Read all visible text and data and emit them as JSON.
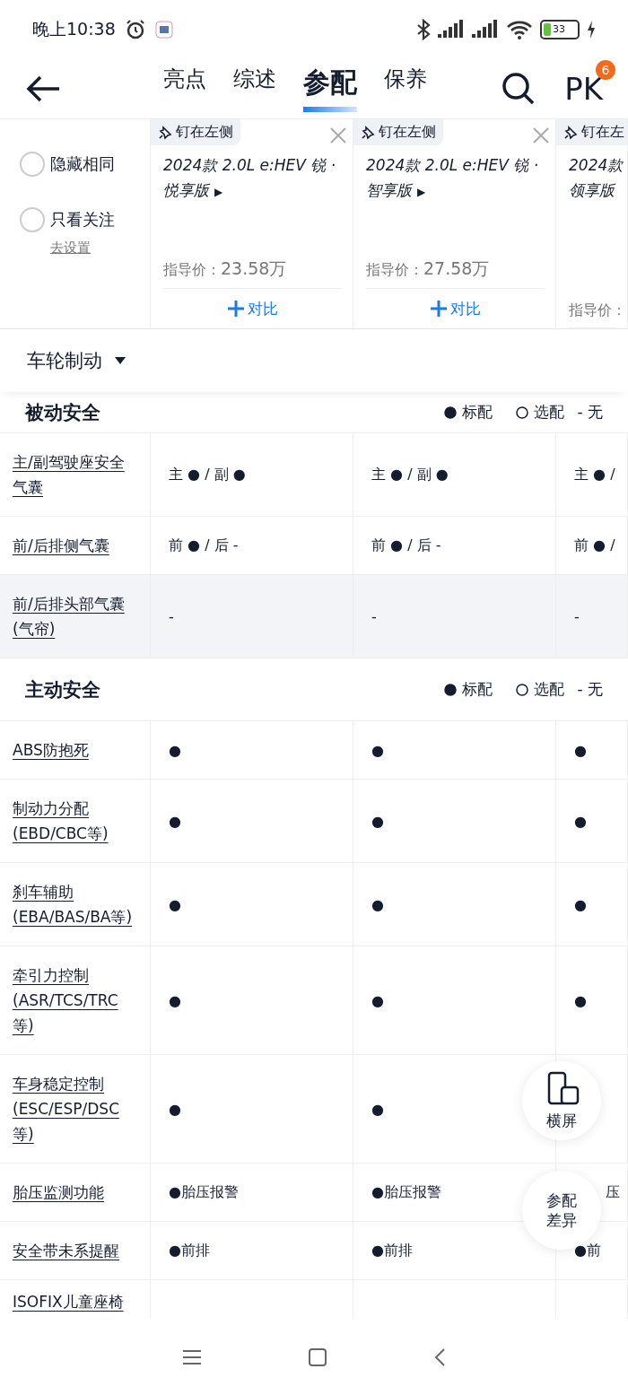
{
  "status_bar": {
    "time": "晚上10:38",
    "battery": "33"
  },
  "nav": {
    "tabs": [
      {
        "label": "亮点",
        "selected": false
      },
      {
        "label": "综述",
        "selected": false
      },
      {
        "label": "参配",
        "selected": true
      },
      {
        "label": "保养",
        "selected": false
      }
    ],
    "pk_label": "PK",
    "pk_badge": "6"
  },
  "filters": [
    {
      "label": "隐藏相同",
      "checked": false
    },
    {
      "label": "只看关注",
      "checked": false
    }
  ],
  "settings_link": "去设置",
  "cars": [
    {
      "pin_label": "钉在左侧",
      "name": [
        "2024款 2.0L e:HEV 锐 ·",
        "悦享版"
      ],
      "more_mark": "▶",
      "price_label": "指导价：",
      "price": "23.58万",
      "compare": "对比",
      "closable": true
    },
    {
      "pin_label": "钉在左侧",
      "name": [
        "2024款 2.0L e:HEV 锐 ·",
        "智享版"
      ],
      "more_mark": "▶",
      "price_label": "指导价：",
      "price": "27.58万",
      "compare": "对比",
      "closable": true
    },
    {
      "pin_label": "钉在左",
      "name": [
        "2024款",
        "领享版"
      ],
      "price_label": "指导价：",
      "closable": false
    }
  ],
  "category": "车轮制动",
  "sections": [
    {
      "title": "被动安全",
      "legend": {
        "standard": "标配",
        "optional": "选配",
        "none": "- 无"
      },
      "rows": [
        {
          "label": "主/副驾驶座安全气囊",
          "highlighted": false,
          "values": [
            "主 ● / 副 ●",
            "主 ● / 副 ●",
            "主 ● /"
          ]
        },
        {
          "label": "前/后排侧气囊",
          "highlighted": false,
          "values": [
            "前 ● / 后 -",
            "前 ● / 后 -",
            "前 ● /"
          ]
        },
        {
          "label": "前/后排头部气囊(气帘)",
          "highlighted": true,
          "values": [
            "-",
            "-",
            "-"
          ]
        }
      ]
    },
    {
      "title": "主动安全",
      "legend": {
        "standard": "标配",
        "optional": "选配",
        "none": "- 无"
      },
      "rows": [
        {
          "label": "ABS防抱死",
          "highlighted": false,
          "values": [
            "●",
            "●",
            "●"
          ]
        },
        {
          "label": "制动力分配(EBD/CBC等)",
          "highlighted": false,
          "values": [
            "●",
            "●",
            "●"
          ]
        },
        {
          "label": "刹车辅助(EBA/BAS/BA等)",
          "highlighted": false,
          "values": [
            "●",
            "●",
            "●"
          ]
        },
        {
          "label": "牵引力控制(ASR/TCS/TRC等)",
          "highlighted": false,
          "values": [
            "●",
            "●",
            "●"
          ]
        },
        {
          "label": "车身稳定控制(ESC/ESP/DSC等)",
          "highlighted": false,
          "values": [
            "●",
            "●"
          ]
        },
        {
          "label": "胎压监测功能",
          "highlighted": false,
          "values": [
            "●胎压报警",
            "●胎压报警",
            "压"
          ],
          "covered": true
        },
        {
          "label": "安全带未系提醒",
          "highlighted": false,
          "values": [
            "●前排",
            "●前排",
            "●前"
          ]
        },
        {
          "label": "ISOFIX儿童座椅",
          "highlighted": false,
          "values": []
        }
      ]
    }
  ],
  "float_buttons": [
    {
      "kind": "rotate",
      "label": "横屏"
    },
    {
      "kind": "text",
      "label": "参配差异"
    }
  ]
}
